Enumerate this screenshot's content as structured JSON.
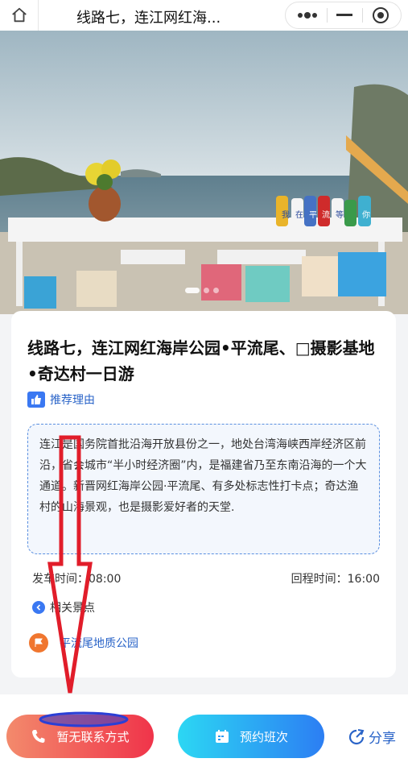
{
  "header": {
    "title": "线路七，连江网红海...",
    "home_icon": "home-icon",
    "more_icon": "more-dots-icon",
    "minimize_icon": "minimize-icon",
    "close_icon": "record-circle-icon"
  },
  "hero": {
    "bottle_chars": [
      "我",
      "在",
      "平",
      "流",
      "等",
      "你"
    ],
    "slide_count": 3,
    "active_slide": 1
  },
  "route": {
    "title": "线路七，连江网红海岸公园•平流尾、□摄影基地•奇达村一日游",
    "reason_label": "推荐理由",
    "description": "连江是国务院首批沿海开放县份之一，地处台湾海峡西岸经济区前沿，省会城市“半小时经济圈”内，是福建省乃至东南沿海的一个大通道。新晋网红海岸公园·平流尾、有多处标志性打卡点；奇达渔村的山海景观，也是摄影爱好者的天堂.",
    "depart_label": "发车时间：",
    "depart_time": "08:00",
    "return_label": "回程时间：",
    "return_time": "16:00",
    "related_label": "相关景点",
    "spot_name": "平流尾地质公园"
  },
  "actions": {
    "contact_label": "暂无联系方式",
    "book_label": "预约班次",
    "share_label": "分享"
  },
  "colors": {
    "accent_blue": "#2a64c8",
    "contact_gradient_start": "#f38a6c",
    "contact_gradient_end": "#f0344a",
    "book_gradient_start": "#2cd7f3",
    "book_gradient_end": "#2c7ef3",
    "annotation_red": "#e11d2a",
    "annotation_blue": "#2a3fd6"
  }
}
